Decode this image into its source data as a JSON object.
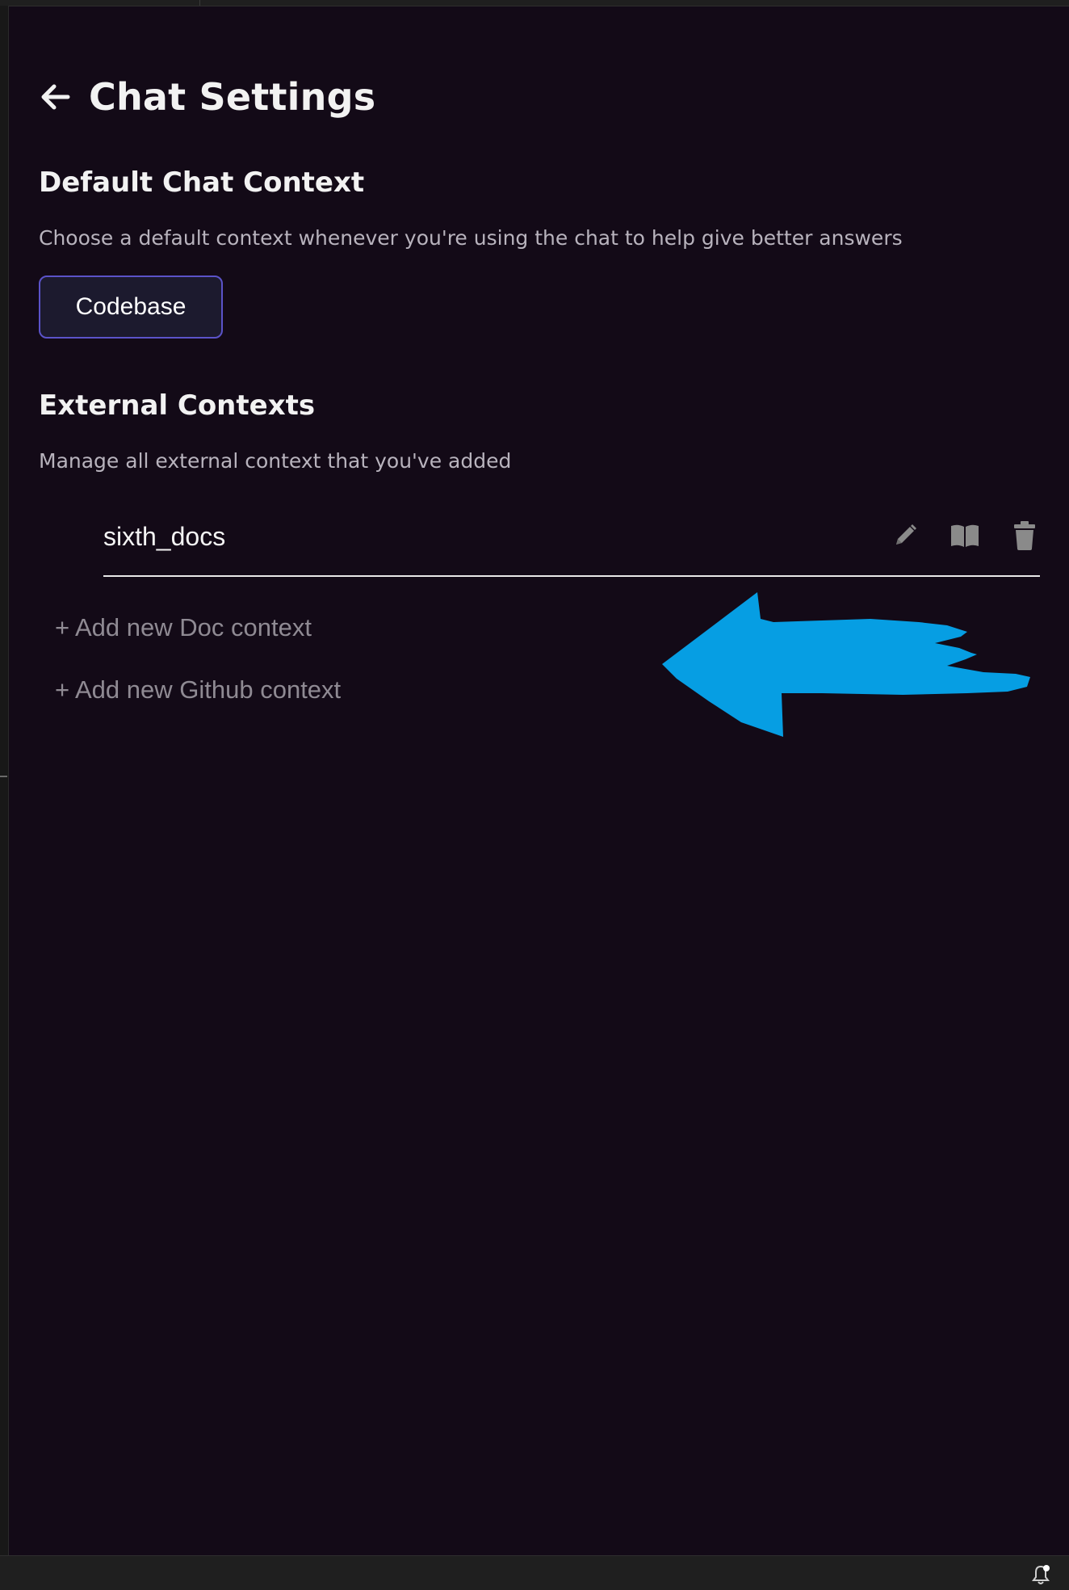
{
  "header": {
    "back_icon": "arrow-left-icon",
    "title": "Chat Settings"
  },
  "default_context": {
    "title": "Default Chat Context",
    "description": "Choose a default context whenever you're using the chat to help give better answers",
    "selected_label": "Codebase"
  },
  "external_contexts": {
    "title": "External Contexts",
    "description": "Manage all external context that you've added",
    "items": [
      {
        "name": "sixth_docs",
        "actions": [
          "pencil-icon",
          "book-icon",
          "trash-icon"
        ]
      }
    ],
    "add_doc_label": "+ Add new Doc context",
    "add_github_label": "+ Add new Github context"
  },
  "annotation": {
    "arrow_color": "#069ee3",
    "icon": "hand-drawn-arrow-left"
  },
  "status_bar": {
    "icon": "bell-notification-icon"
  },
  "colors": {
    "background": "#130a17",
    "accent_border": "#5b53c9",
    "icon_gray": "#8a8a8a"
  }
}
